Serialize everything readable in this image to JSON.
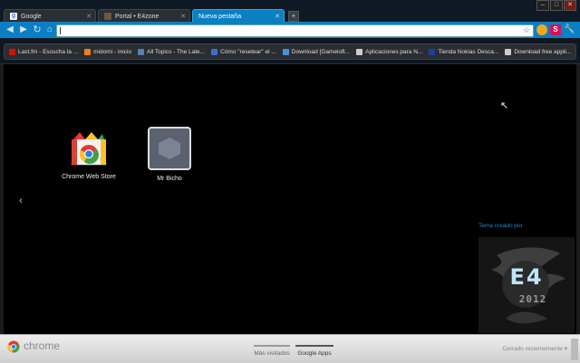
{
  "tabs": [
    {
      "title": "Google",
      "active": false
    },
    {
      "title": "Portal • E4zone",
      "active": false
    },
    {
      "title": "Nueva pestaña",
      "active": true
    }
  ],
  "toolbar": {
    "omnibox_value": ""
  },
  "bookmarks": [
    {
      "label": "Last.fm - Escucha la ...",
      "icon": "lastfm-icon",
      "color": "#d51007"
    },
    {
      "label": "midomi - Inicio",
      "icon": "midomi-icon",
      "color": "#f07f1a"
    },
    {
      "label": "All Topics - The Late...",
      "icon": "forum-icon",
      "color": "#5a7fb0"
    },
    {
      "label": "Cómo \"resetear\" el ...",
      "icon": "page-icon",
      "color": "#3a6fcf"
    },
    {
      "label": "Download [Gameloft...",
      "icon": "download-icon",
      "color": "#4a90d9"
    },
    {
      "label": "Aplicaciones para N...",
      "icon": "page-icon",
      "color": "#cccccc"
    },
    {
      "label": "Tienda Nokias Desca...",
      "icon": "nokia-icon",
      "color": "#1a3fa0"
    },
    {
      "label": "Download free appli...",
      "icon": "page-icon",
      "color": "#cccccc"
    }
  ],
  "apps": [
    {
      "label": "Chrome Web Store",
      "icon": "chrome-web-store-icon"
    },
    {
      "label": "Mr Bicho",
      "icon": "generic-app-icon"
    }
  ],
  "theme": {
    "credit": "Tema creado por",
    "logo_text": "E4",
    "logo_year": "2012"
  },
  "footer": {
    "brand": "chrome",
    "nav": [
      {
        "label": "Más visitados",
        "selected": false
      },
      {
        "label": "Google Apps",
        "selected": true
      }
    ],
    "recent": "Cerrado recientemente"
  },
  "colors": {
    "accent": "#0b7fc4",
    "theme_text": "#1e88cc"
  }
}
